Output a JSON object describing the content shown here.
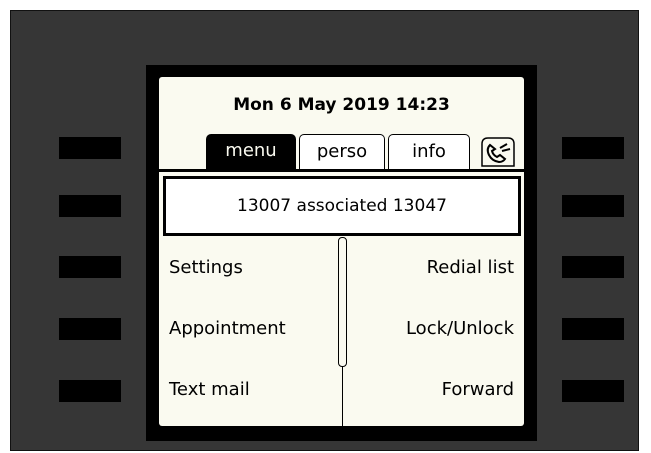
{
  "datetime": "Mon 6 May 2019  14:23",
  "tabs": [
    {
      "label": "menu",
      "active": true
    },
    {
      "label": "perso",
      "active": false
    },
    {
      "label": "info",
      "active": false
    }
  ],
  "status_line": "13007 associated 13047",
  "menu": {
    "left": [
      "Settings",
      "Appointment",
      "Text mail"
    ],
    "right": [
      "Redial list",
      "Lock/Unlock",
      "Forward"
    ]
  },
  "icons": {
    "handset": "handset-icon"
  },
  "colors": {
    "frame": "#363636",
    "screen": "#fafaf0",
    "black": "#000000"
  }
}
